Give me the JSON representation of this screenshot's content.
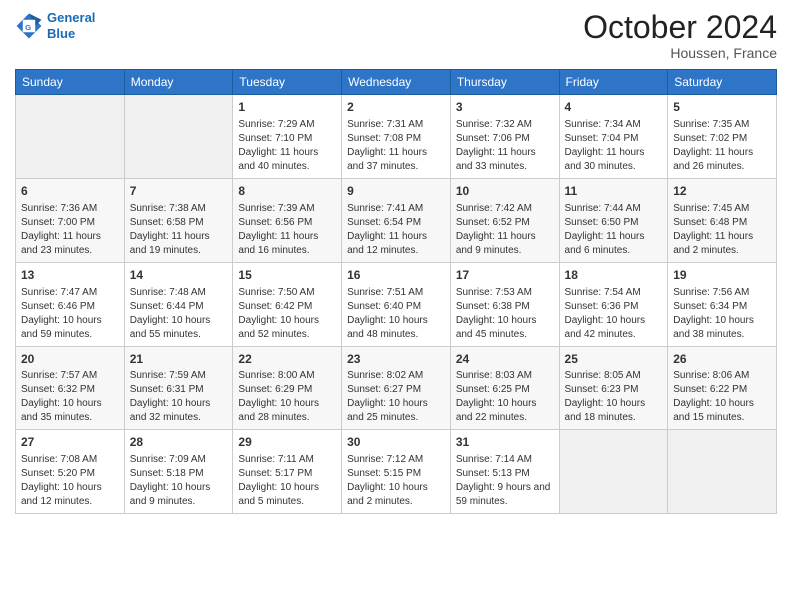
{
  "header": {
    "logo_line1": "General",
    "logo_line2": "Blue",
    "month_title": "October 2024",
    "location": "Houssen, France"
  },
  "weekdays": [
    "Sunday",
    "Monday",
    "Tuesday",
    "Wednesday",
    "Thursday",
    "Friday",
    "Saturday"
  ],
  "weeks": [
    [
      {
        "day": "",
        "empty": true
      },
      {
        "day": "",
        "empty": true
      },
      {
        "day": "1",
        "sunrise": "Sunrise: 7:29 AM",
        "sunset": "Sunset: 7:10 PM",
        "daylight": "Daylight: 11 hours and 40 minutes."
      },
      {
        "day": "2",
        "sunrise": "Sunrise: 7:31 AM",
        "sunset": "Sunset: 7:08 PM",
        "daylight": "Daylight: 11 hours and 37 minutes."
      },
      {
        "day": "3",
        "sunrise": "Sunrise: 7:32 AM",
        "sunset": "Sunset: 7:06 PM",
        "daylight": "Daylight: 11 hours and 33 minutes."
      },
      {
        "day": "4",
        "sunrise": "Sunrise: 7:34 AM",
        "sunset": "Sunset: 7:04 PM",
        "daylight": "Daylight: 11 hours and 30 minutes."
      },
      {
        "day": "5",
        "sunrise": "Sunrise: 7:35 AM",
        "sunset": "Sunset: 7:02 PM",
        "daylight": "Daylight: 11 hours and 26 minutes."
      }
    ],
    [
      {
        "day": "6",
        "sunrise": "Sunrise: 7:36 AM",
        "sunset": "Sunset: 7:00 PM",
        "daylight": "Daylight: 11 hours and 23 minutes."
      },
      {
        "day": "7",
        "sunrise": "Sunrise: 7:38 AM",
        "sunset": "Sunset: 6:58 PM",
        "daylight": "Daylight: 11 hours and 19 minutes."
      },
      {
        "day": "8",
        "sunrise": "Sunrise: 7:39 AM",
        "sunset": "Sunset: 6:56 PM",
        "daylight": "Daylight: 11 hours and 16 minutes."
      },
      {
        "day": "9",
        "sunrise": "Sunrise: 7:41 AM",
        "sunset": "Sunset: 6:54 PM",
        "daylight": "Daylight: 11 hours and 12 minutes."
      },
      {
        "day": "10",
        "sunrise": "Sunrise: 7:42 AM",
        "sunset": "Sunset: 6:52 PM",
        "daylight": "Daylight: 11 hours and 9 minutes."
      },
      {
        "day": "11",
        "sunrise": "Sunrise: 7:44 AM",
        "sunset": "Sunset: 6:50 PM",
        "daylight": "Daylight: 11 hours and 6 minutes."
      },
      {
        "day": "12",
        "sunrise": "Sunrise: 7:45 AM",
        "sunset": "Sunset: 6:48 PM",
        "daylight": "Daylight: 11 hours and 2 minutes."
      }
    ],
    [
      {
        "day": "13",
        "sunrise": "Sunrise: 7:47 AM",
        "sunset": "Sunset: 6:46 PM",
        "daylight": "Daylight: 10 hours and 59 minutes."
      },
      {
        "day": "14",
        "sunrise": "Sunrise: 7:48 AM",
        "sunset": "Sunset: 6:44 PM",
        "daylight": "Daylight: 10 hours and 55 minutes."
      },
      {
        "day": "15",
        "sunrise": "Sunrise: 7:50 AM",
        "sunset": "Sunset: 6:42 PM",
        "daylight": "Daylight: 10 hours and 52 minutes."
      },
      {
        "day": "16",
        "sunrise": "Sunrise: 7:51 AM",
        "sunset": "Sunset: 6:40 PM",
        "daylight": "Daylight: 10 hours and 48 minutes."
      },
      {
        "day": "17",
        "sunrise": "Sunrise: 7:53 AM",
        "sunset": "Sunset: 6:38 PM",
        "daylight": "Daylight: 10 hours and 45 minutes."
      },
      {
        "day": "18",
        "sunrise": "Sunrise: 7:54 AM",
        "sunset": "Sunset: 6:36 PM",
        "daylight": "Daylight: 10 hours and 42 minutes."
      },
      {
        "day": "19",
        "sunrise": "Sunrise: 7:56 AM",
        "sunset": "Sunset: 6:34 PM",
        "daylight": "Daylight: 10 hours and 38 minutes."
      }
    ],
    [
      {
        "day": "20",
        "sunrise": "Sunrise: 7:57 AM",
        "sunset": "Sunset: 6:32 PM",
        "daylight": "Daylight: 10 hours and 35 minutes."
      },
      {
        "day": "21",
        "sunrise": "Sunrise: 7:59 AM",
        "sunset": "Sunset: 6:31 PM",
        "daylight": "Daylight: 10 hours and 32 minutes."
      },
      {
        "day": "22",
        "sunrise": "Sunrise: 8:00 AM",
        "sunset": "Sunset: 6:29 PM",
        "daylight": "Daylight: 10 hours and 28 minutes."
      },
      {
        "day": "23",
        "sunrise": "Sunrise: 8:02 AM",
        "sunset": "Sunset: 6:27 PM",
        "daylight": "Daylight: 10 hours and 25 minutes."
      },
      {
        "day": "24",
        "sunrise": "Sunrise: 8:03 AM",
        "sunset": "Sunset: 6:25 PM",
        "daylight": "Daylight: 10 hours and 22 minutes."
      },
      {
        "day": "25",
        "sunrise": "Sunrise: 8:05 AM",
        "sunset": "Sunset: 6:23 PM",
        "daylight": "Daylight: 10 hours and 18 minutes."
      },
      {
        "day": "26",
        "sunrise": "Sunrise: 8:06 AM",
        "sunset": "Sunset: 6:22 PM",
        "daylight": "Daylight: 10 hours and 15 minutes."
      }
    ],
    [
      {
        "day": "27",
        "sunrise": "Sunrise: 7:08 AM",
        "sunset": "Sunset: 5:20 PM",
        "daylight": "Daylight: 10 hours and 12 minutes."
      },
      {
        "day": "28",
        "sunrise": "Sunrise: 7:09 AM",
        "sunset": "Sunset: 5:18 PM",
        "daylight": "Daylight: 10 hours and 9 minutes."
      },
      {
        "day": "29",
        "sunrise": "Sunrise: 7:11 AM",
        "sunset": "Sunset: 5:17 PM",
        "daylight": "Daylight: 10 hours and 5 minutes."
      },
      {
        "day": "30",
        "sunrise": "Sunrise: 7:12 AM",
        "sunset": "Sunset: 5:15 PM",
        "daylight": "Daylight: 10 hours and 2 minutes."
      },
      {
        "day": "31",
        "sunrise": "Sunrise: 7:14 AM",
        "sunset": "Sunset: 5:13 PM",
        "daylight": "Daylight: 9 hours and 59 minutes."
      },
      {
        "day": "",
        "empty": true
      },
      {
        "day": "",
        "empty": true
      }
    ]
  ]
}
